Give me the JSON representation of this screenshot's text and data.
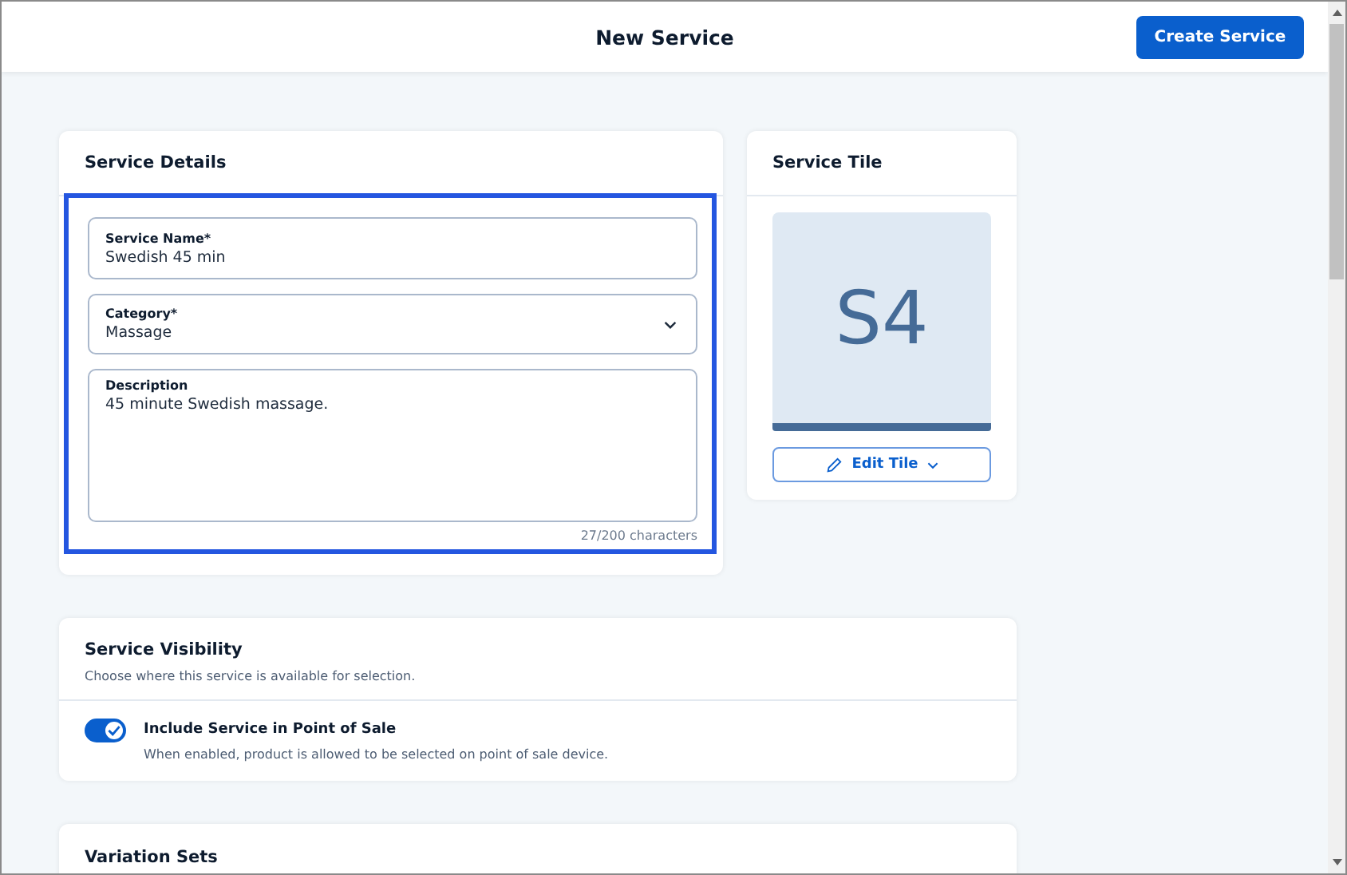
{
  "header": {
    "title": "New Service",
    "action": "Create Service"
  },
  "service_details": {
    "title": "Service Details",
    "highlighted": true,
    "fields": [
      {
        "kind": "text",
        "label": "Service Name*",
        "value": "Swedish 45 min"
      },
      {
        "kind": "select",
        "label": "Category*",
        "value": "Massage"
      },
      {
        "kind": "textarea",
        "label": "Description",
        "value": "45 minute Swedish massage."
      }
    ],
    "char_count": "27/200 characters"
  },
  "service_tile": {
    "title": "Service Tile",
    "tile_text": "S4",
    "button": "Edit Tile"
  },
  "service_visibility": {
    "title": "Service Visibility",
    "subtitle": "Choose where this service is available for selection.",
    "toggles": [
      {
        "label": "Include Service in Point of Sale",
        "hint": "When enabled, product is allowed to be selected on point of sale device.",
        "on": true
      }
    ]
  },
  "variation_sets": {
    "title": "Variation Sets"
  }
}
